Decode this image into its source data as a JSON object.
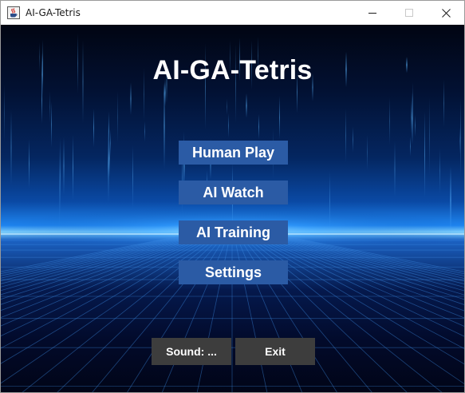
{
  "window": {
    "title": "AI-GA-Tetris",
    "icon": "java-coffee-cup-icon",
    "controls": [
      "minimize-icon",
      "maximize-icon",
      "close-icon"
    ]
  },
  "game": {
    "title": "AI-GA-Tetris",
    "menu": [
      {
        "label": "Human Play"
      },
      {
        "label": "AI Watch"
      },
      {
        "label": "AI Training"
      },
      {
        "label": "Settings"
      }
    ],
    "sound_button": {
      "label": "Sound: ..."
    },
    "exit_button": {
      "label": "Exit"
    }
  },
  "colors": {
    "menu_button_bg": "#2b5ba5",
    "bottom_button_bg": "#3d3d3d",
    "horizon_glow": "#7fd2ff",
    "background_dark": "#010512"
  }
}
